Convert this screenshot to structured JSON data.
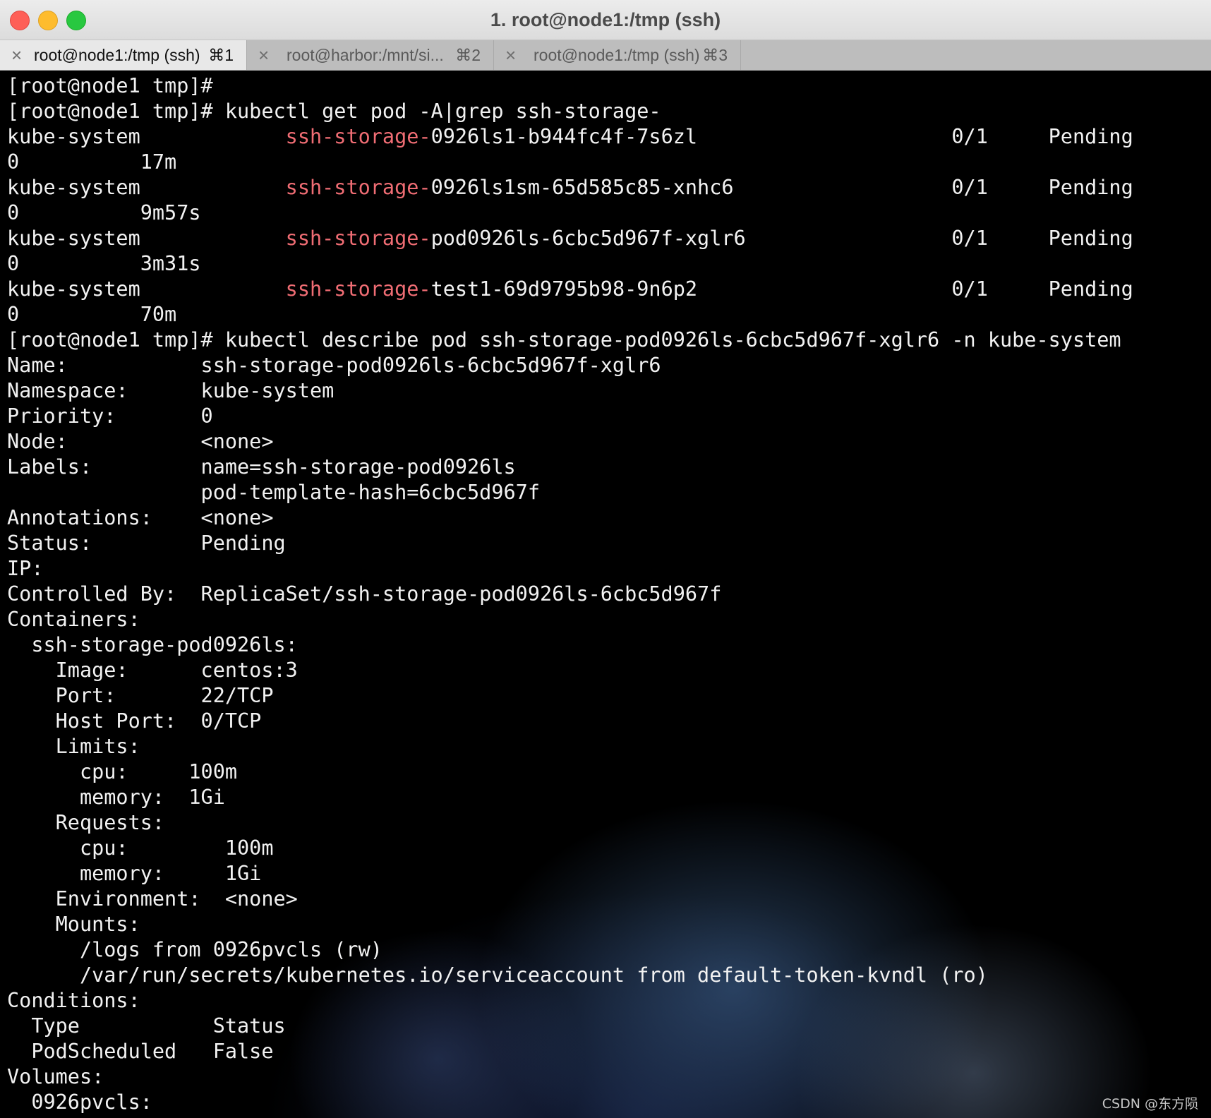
{
  "window": {
    "title": "1. root@node1:/tmp (ssh)"
  },
  "tabs": [
    {
      "label": "root@node1:/tmp (ssh)",
      "shortcut": "⌘1",
      "active": true
    },
    {
      "label": "root@harbor:/mnt/si...",
      "shortcut": "⌘2",
      "active": false
    },
    {
      "label": "root@node1:/tmp (ssh)",
      "shortcut": "⌘3",
      "active": false
    }
  ],
  "colors": {
    "highlight": "#f06d74",
    "text": "#f2f2f2",
    "background": "#000000"
  },
  "terminal": {
    "lines": [
      {
        "text": "[root@node1 tmp]#"
      },
      {
        "text": "[root@node1 tmp]# kubectl get pod -A|grep ssh-storage-"
      },
      {
        "pre": "kube-system            ",
        "hl": "ssh-storage-",
        "post": "0926ls1-b944fc4f-7s6zl                     0/1     Pending"
      },
      {
        "text": "0          17m"
      },
      {
        "pre": "kube-system            ",
        "hl": "ssh-storage-",
        "post": "0926ls1sm-65d585c85-xnhc6                  0/1     Pending"
      },
      {
        "text": "0          9m57s"
      },
      {
        "pre": "kube-system            ",
        "hl": "ssh-storage-",
        "post": "pod0926ls-6cbc5d967f-xglr6                 0/1     Pending"
      },
      {
        "text": "0          3m31s"
      },
      {
        "pre": "kube-system            ",
        "hl": "ssh-storage-",
        "post": "test1-69d9795b98-9n6p2                     0/1     Pending"
      },
      {
        "text": "0          70m"
      },
      {
        "text": "[root@node1 tmp]# kubectl describe pod ssh-storage-pod0926ls-6cbc5d967f-xglr6 -n kube-system"
      },
      {
        "text": "Name:           ssh-storage-pod0926ls-6cbc5d967f-xglr6"
      },
      {
        "text": "Namespace:      kube-system"
      },
      {
        "text": "Priority:       0"
      },
      {
        "text": "Node:           <none>"
      },
      {
        "text": "Labels:         name=ssh-storage-pod0926ls"
      },
      {
        "text": "                pod-template-hash=6cbc5d967f"
      },
      {
        "text": "Annotations:    <none>"
      },
      {
        "text": "Status:         Pending"
      },
      {
        "text": "IP:"
      },
      {
        "text": "Controlled By:  ReplicaSet/ssh-storage-pod0926ls-6cbc5d967f"
      },
      {
        "text": "Containers:"
      },
      {
        "text": "  ssh-storage-pod0926ls:"
      },
      {
        "text": "    Image:      centos:3"
      },
      {
        "text": "    Port:       22/TCP"
      },
      {
        "text": "    Host Port:  0/TCP"
      },
      {
        "text": "    Limits:"
      },
      {
        "text": "      cpu:     100m"
      },
      {
        "text": "      memory:  1Gi"
      },
      {
        "text": "    Requests:"
      },
      {
        "text": "      cpu:        100m"
      },
      {
        "text": "      memory:     1Gi"
      },
      {
        "text": "    Environment:  <none>"
      },
      {
        "text": "    Mounts:"
      },
      {
        "text": "      /logs from 0926pvcls (rw)"
      },
      {
        "text": "      /var/run/secrets/kubernetes.io/serviceaccount from default-token-kvndl (ro)"
      },
      {
        "text": "Conditions:"
      },
      {
        "text": "  Type           Status"
      },
      {
        "text": "  PodScheduled   False"
      },
      {
        "text": "Volumes:"
      },
      {
        "text": "  0926pvcls:"
      }
    ]
  },
  "watermark": "CSDN @东方陨"
}
